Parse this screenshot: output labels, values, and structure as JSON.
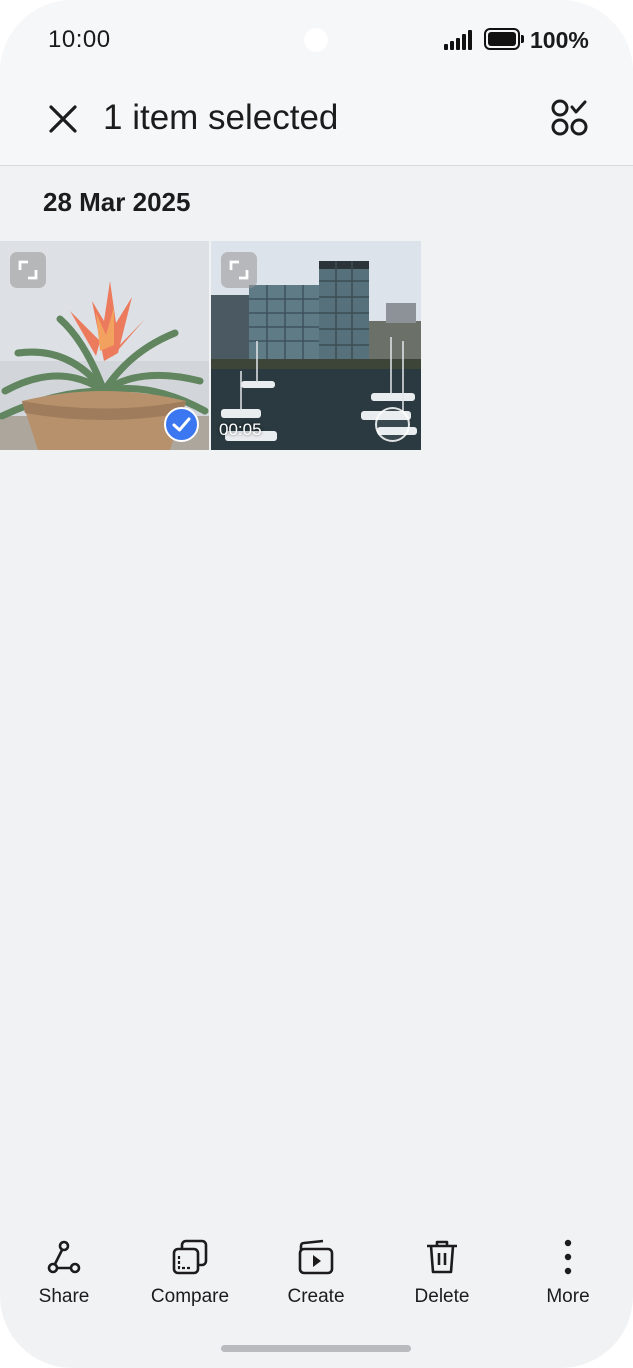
{
  "status_bar": {
    "time": "10:00",
    "battery": "100%",
    "signal_icon": "signal-icon",
    "battery_icon": "battery-icon"
  },
  "action_bar": {
    "title": "1 item selected",
    "close_icon": "close-icon",
    "select_mode_icon": "select-mode-icon"
  },
  "gallery": {
    "date": "28 Mar 2025",
    "items": [
      {
        "type": "photo",
        "subject": "bromeliad-in-pot",
        "selected": true
      },
      {
        "type": "video",
        "subject": "harbor-with-boats",
        "duration": "00:05",
        "selected": false
      }
    ]
  },
  "toolbar": {
    "items": [
      {
        "label": "Share",
        "icon": "share-icon"
      },
      {
        "label": "Compare",
        "icon": "compare-icon"
      },
      {
        "label": "Create",
        "icon": "create-icon"
      },
      {
        "label": "Delete",
        "icon": "delete-icon"
      },
      {
        "label": "More",
        "icon": "more-icon"
      }
    ]
  },
  "colors": {
    "accent": "#3a77f0",
    "background": "#f1f2f4",
    "bar": "#f6f7f9"
  }
}
